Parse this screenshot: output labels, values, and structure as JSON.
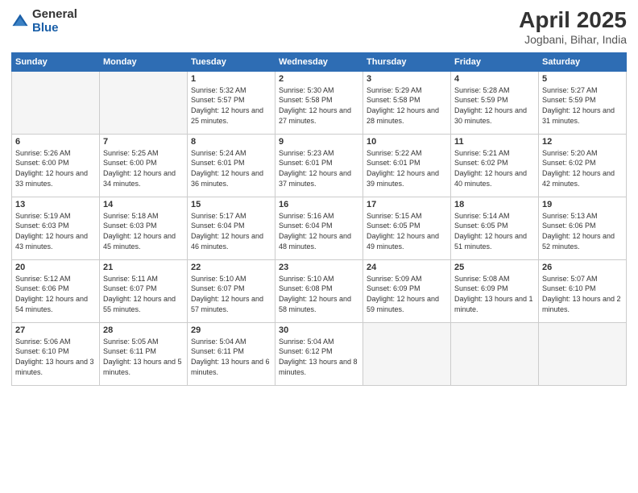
{
  "logo": {
    "general": "General",
    "blue": "Blue"
  },
  "title": {
    "month": "April 2025",
    "location": "Jogbani, Bihar, India"
  },
  "headers": [
    "Sunday",
    "Monday",
    "Tuesday",
    "Wednesday",
    "Thursday",
    "Friday",
    "Saturday"
  ],
  "weeks": [
    [
      {
        "day": "",
        "empty": true
      },
      {
        "day": "",
        "empty": true
      },
      {
        "day": "1",
        "sunrise": "Sunrise: 5:32 AM",
        "sunset": "Sunset: 5:57 PM",
        "daylight": "Daylight: 12 hours and 25 minutes."
      },
      {
        "day": "2",
        "sunrise": "Sunrise: 5:30 AM",
        "sunset": "Sunset: 5:58 PM",
        "daylight": "Daylight: 12 hours and 27 minutes."
      },
      {
        "day": "3",
        "sunrise": "Sunrise: 5:29 AM",
        "sunset": "Sunset: 5:58 PM",
        "daylight": "Daylight: 12 hours and 28 minutes."
      },
      {
        "day": "4",
        "sunrise": "Sunrise: 5:28 AM",
        "sunset": "Sunset: 5:59 PM",
        "daylight": "Daylight: 12 hours and 30 minutes."
      },
      {
        "day": "5",
        "sunrise": "Sunrise: 5:27 AM",
        "sunset": "Sunset: 5:59 PM",
        "daylight": "Daylight: 12 hours and 31 minutes."
      }
    ],
    [
      {
        "day": "6",
        "sunrise": "Sunrise: 5:26 AM",
        "sunset": "Sunset: 6:00 PM",
        "daylight": "Daylight: 12 hours and 33 minutes."
      },
      {
        "day": "7",
        "sunrise": "Sunrise: 5:25 AM",
        "sunset": "Sunset: 6:00 PM",
        "daylight": "Daylight: 12 hours and 34 minutes."
      },
      {
        "day": "8",
        "sunrise": "Sunrise: 5:24 AM",
        "sunset": "Sunset: 6:01 PM",
        "daylight": "Daylight: 12 hours and 36 minutes."
      },
      {
        "day": "9",
        "sunrise": "Sunrise: 5:23 AM",
        "sunset": "Sunset: 6:01 PM",
        "daylight": "Daylight: 12 hours and 37 minutes."
      },
      {
        "day": "10",
        "sunrise": "Sunrise: 5:22 AM",
        "sunset": "Sunset: 6:01 PM",
        "daylight": "Daylight: 12 hours and 39 minutes."
      },
      {
        "day": "11",
        "sunrise": "Sunrise: 5:21 AM",
        "sunset": "Sunset: 6:02 PM",
        "daylight": "Daylight: 12 hours and 40 minutes."
      },
      {
        "day": "12",
        "sunrise": "Sunrise: 5:20 AM",
        "sunset": "Sunset: 6:02 PM",
        "daylight": "Daylight: 12 hours and 42 minutes."
      }
    ],
    [
      {
        "day": "13",
        "sunrise": "Sunrise: 5:19 AM",
        "sunset": "Sunset: 6:03 PM",
        "daylight": "Daylight: 12 hours and 43 minutes."
      },
      {
        "day": "14",
        "sunrise": "Sunrise: 5:18 AM",
        "sunset": "Sunset: 6:03 PM",
        "daylight": "Daylight: 12 hours and 45 minutes."
      },
      {
        "day": "15",
        "sunrise": "Sunrise: 5:17 AM",
        "sunset": "Sunset: 6:04 PM",
        "daylight": "Daylight: 12 hours and 46 minutes."
      },
      {
        "day": "16",
        "sunrise": "Sunrise: 5:16 AM",
        "sunset": "Sunset: 6:04 PM",
        "daylight": "Daylight: 12 hours and 48 minutes."
      },
      {
        "day": "17",
        "sunrise": "Sunrise: 5:15 AM",
        "sunset": "Sunset: 6:05 PM",
        "daylight": "Daylight: 12 hours and 49 minutes."
      },
      {
        "day": "18",
        "sunrise": "Sunrise: 5:14 AM",
        "sunset": "Sunset: 6:05 PM",
        "daylight": "Daylight: 12 hours and 51 minutes."
      },
      {
        "day": "19",
        "sunrise": "Sunrise: 5:13 AM",
        "sunset": "Sunset: 6:06 PM",
        "daylight": "Daylight: 12 hours and 52 minutes."
      }
    ],
    [
      {
        "day": "20",
        "sunrise": "Sunrise: 5:12 AM",
        "sunset": "Sunset: 6:06 PM",
        "daylight": "Daylight: 12 hours and 54 minutes."
      },
      {
        "day": "21",
        "sunrise": "Sunrise: 5:11 AM",
        "sunset": "Sunset: 6:07 PM",
        "daylight": "Daylight: 12 hours and 55 minutes."
      },
      {
        "day": "22",
        "sunrise": "Sunrise: 5:10 AM",
        "sunset": "Sunset: 6:07 PM",
        "daylight": "Daylight: 12 hours and 57 minutes."
      },
      {
        "day": "23",
        "sunrise": "Sunrise: 5:10 AM",
        "sunset": "Sunset: 6:08 PM",
        "daylight": "Daylight: 12 hours and 58 minutes."
      },
      {
        "day": "24",
        "sunrise": "Sunrise: 5:09 AM",
        "sunset": "Sunset: 6:09 PM",
        "daylight": "Daylight: 12 hours and 59 minutes."
      },
      {
        "day": "25",
        "sunrise": "Sunrise: 5:08 AM",
        "sunset": "Sunset: 6:09 PM",
        "daylight": "Daylight: 13 hours and 1 minute."
      },
      {
        "day": "26",
        "sunrise": "Sunrise: 5:07 AM",
        "sunset": "Sunset: 6:10 PM",
        "daylight": "Daylight: 13 hours and 2 minutes."
      }
    ],
    [
      {
        "day": "27",
        "sunrise": "Sunrise: 5:06 AM",
        "sunset": "Sunset: 6:10 PM",
        "daylight": "Daylight: 13 hours and 3 minutes."
      },
      {
        "day": "28",
        "sunrise": "Sunrise: 5:05 AM",
        "sunset": "Sunset: 6:11 PM",
        "daylight": "Daylight: 13 hours and 5 minutes."
      },
      {
        "day": "29",
        "sunrise": "Sunrise: 5:04 AM",
        "sunset": "Sunset: 6:11 PM",
        "daylight": "Daylight: 13 hours and 6 minutes."
      },
      {
        "day": "30",
        "sunrise": "Sunrise: 5:04 AM",
        "sunset": "Sunset: 6:12 PM",
        "daylight": "Daylight: 13 hours and 8 minutes."
      },
      {
        "day": "",
        "empty": true
      },
      {
        "day": "",
        "empty": true
      },
      {
        "day": "",
        "empty": true
      }
    ]
  ]
}
